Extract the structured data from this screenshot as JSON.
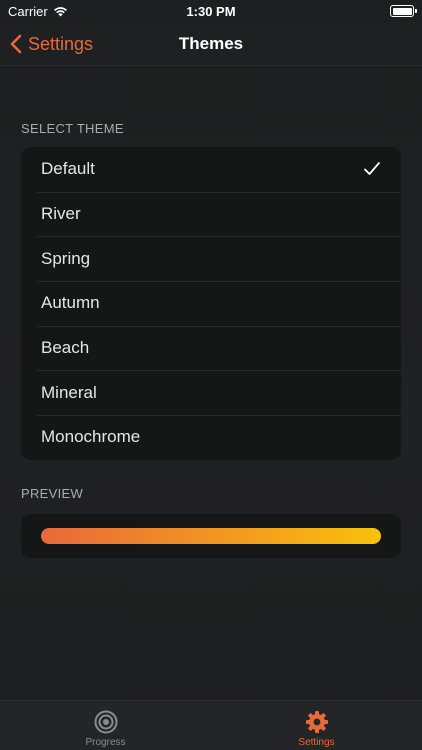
{
  "status_bar": {
    "carrier": "Carrier",
    "time": "1:30 PM"
  },
  "nav": {
    "back_label": "Settings",
    "title": "Themes"
  },
  "themes": {
    "header": "SELECT THEME",
    "items": [
      {
        "label": "Default",
        "selected": true
      },
      {
        "label": "River",
        "selected": false
      },
      {
        "label": "Spring",
        "selected": false
      },
      {
        "label": "Autumn",
        "selected": false
      },
      {
        "label": "Beach",
        "selected": false
      },
      {
        "label": "Mineral",
        "selected": false
      },
      {
        "label": "Monochrome",
        "selected": false
      }
    ]
  },
  "preview": {
    "header": "PREVIEW",
    "gradient_start": "#e8693a",
    "gradient_end": "#f9c10a"
  },
  "tab_bar": {
    "tabs": [
      {
        "label": "Progress",
        "icon": "target-icon",
        "active": false
      },
      {
        "label": "Settings",
        "icon": "gear-icon",
        "active": true
      }
    ]
  },
  "colors": {
    "accent": "#e8693a",
    "background": "#1e1f20",
    "group_background": "#151616"
  }
}
